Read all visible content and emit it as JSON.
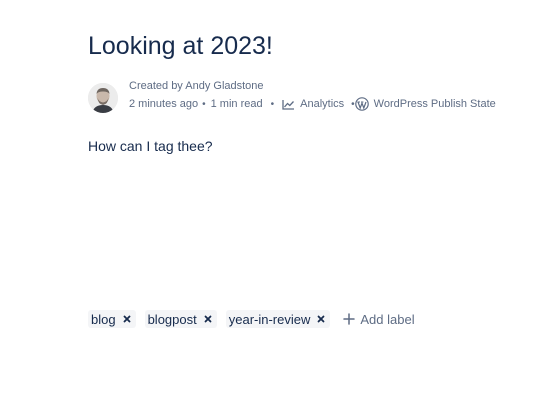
{
  "page": {
    "title": "Looking at 2023!",
    "body": "How can I tag thee?"
  },
  "byline": {
    "created_by": "Created by Andy Gladstone",
    "time_ago": "2 minutes ago",
    "read_time": "1 min read",
    "analytics_label": "Analytics",
    "wordpress_label": "WordPress Publish State",
    "analytics_icon": "chart-line-icon",
    "wordpress_icon": "wordpress-icon"
  },
  "labels": {
    "items": [
      {
        "text": "blog"
      },
      {
        "text": "blogpost"
      },
      {
        "text": "year-in-review"
      }
    ],
    "add_label": "Add label"
  },
  "colors": {
    "text_primary": "#172b4d",
    "text_subtle": "#5e6c84",
    "label_bg": "#f4f5f7"
  }
}
